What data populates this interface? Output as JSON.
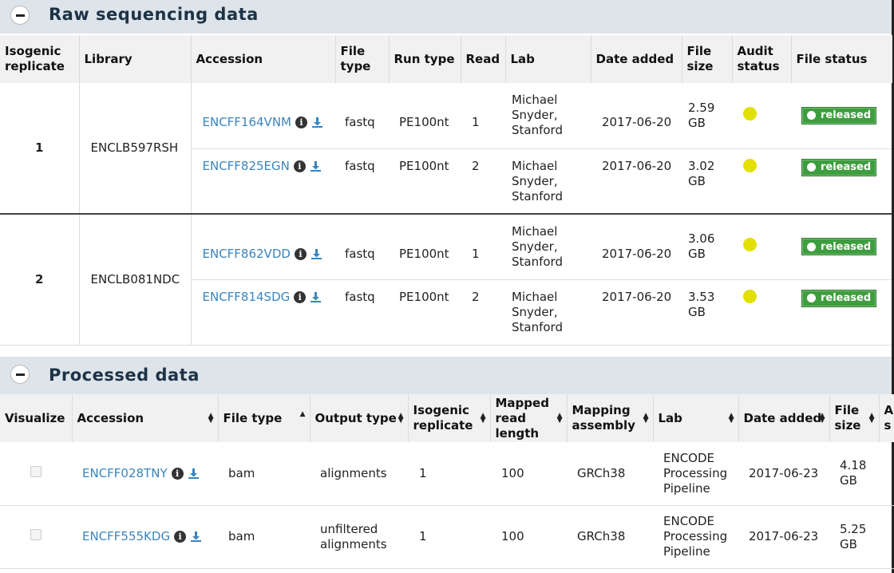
{
  "raw": {
    "title": "Raw sequencing data",
    "headers": [
      "Isogenic replicate",
      "Library",
      "Accession",
      "File type",
      "Run type",
      "Read",
      "Lab",
      "Date added",
      "File size",
      "Audit status",
      "File status"
    ],
    "groups": [
      {
        "replicate": "1",
        "library": "ENCLB597RSH",
        "files": [
          {
            "accession": "ENCFF164VNM",
            "file_type": "fastq",
            "run_type": "PE100nt",
            "read": "1",
            "lab": "Michael Snyder, Stanford",
            "date": "2017-06-20",
            "size": "2.59 GB",
            "status": "released"
          },
          {
            "accession": "ENCFF825EGN",
            "file_type": "fastq",
            "run_type": "PE100nt",
            "read": "2",
            "lab": "Michael Snyder, Stanford",
            "date": "2017-06-20",
            "size": "3.02 GB",
            "status": "released"
          }
        ]
      },
      {
        "replicate": "2",
        "library": "ENCLB081NDC",
        "files": [
          {
            "accession": "ENCFF862VDD",
            "file_type": "fastq",
            "run_type": "PE100nt",
            "read": "1",
            "lab": "Michael Snyder, Stanford",
            "date": "2017-06-20",
            "size": "3.06 GB",
            "status": "released"
          },
          {
            "accession": "ENCFF814SDG",
            "file_type": "fastq",
            "run_type": "PE100nt",
            "read": "2",
            "lab": "Michael Snyder, Stanford",
            "date": "2017-06-20",
            "size": "3.53 GB",
            "status": "released"
          }
        ]
      }
    ]
  },
  "processed": {
    "title": "Processed data",
    "headers": [
      "Visualize",
      "Accession",
      "File type",
      "Output type",
      "Isogenic replicate",
      "Mapped read length",
      "Mapping assembly",
      "Lab",
      "Date added",
      "File size",
      "A s"
    ],
    "rows": [
      {
        "accession": "ENCFF028TNY",
        "file_type": "bam",
        "output_type": "alignments",
        "replicate": "1",
        "read_length": "100",
        "assembly": "GRCh38",
        "lab": "ENCODE Processing Pipeline",
        "date": "2017-06-23",
        "size": "4.18 GB"
      },
      {
        "accession": "ENCFF555KDG",
        "file_type": "bam",
        "output_type": "unfiltered alignments",
        "replicate": "1",
        "read_length": "100",
        "assembly": "GRCh38",
        "lab": "ENCODE Processing Pipeline",
        "date": "2017-06-23",
        "size": "5.25 GB"
      }
    ]
  },
  "icons": {
    "toggle": "minus-circle-icon",
    "info": "info-icon",
    "download": "download-icon",
    "audit": "audit-dot-icon",
    "sort": "sort-arrows-icon"
  },
  "colors": {
    "link": "#3a84be",
    "released_badge": "#3e9d3e",
    "audit_dot": "#e2e000",
    "section_header": "#dde4ea"
  }
}
